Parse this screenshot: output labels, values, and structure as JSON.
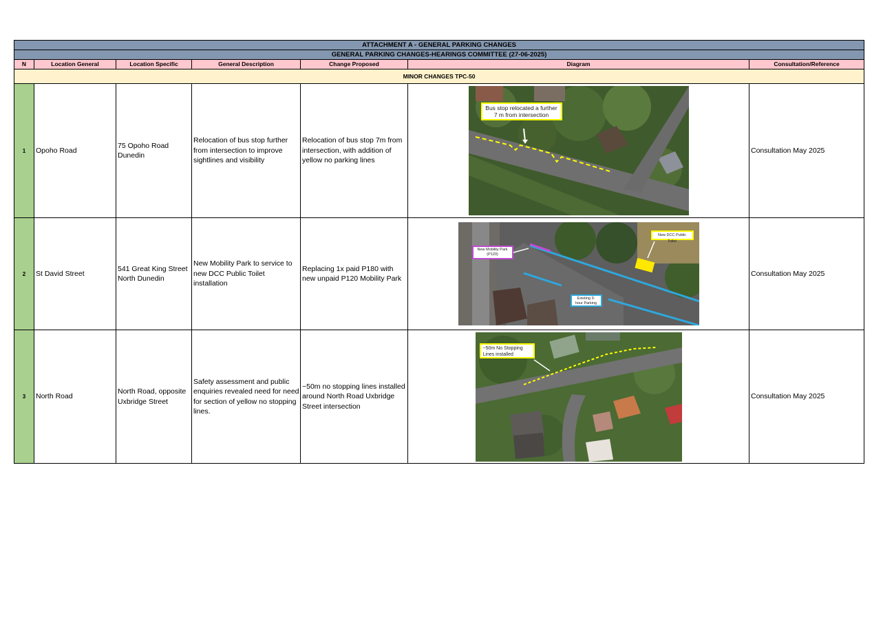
{
  "title": "ATTACHMENT A - GENERAL PARKING CHANGES",
  "subtitle": "GENERAL PARKING CHANGES-HEARINGS COMMITTEE (27-06-2025)",
  "columns": [
    "N",
    "Location General",
    "Location Specific",
    "General Description",
    "Change Proposed",
    "Diagram",
    "Consultation/Reference"
  ],
  "section": "MINOR CHANGES TPC-50",
  "rows": [
    {
      "n": "1",
      "location_general": "Opoho Road",
      "location_specific": "75 Opoho Road Dunedin",
      "description": "Relocation of bus stop further from intersection to improve sightlines and visibility",
      "change": "Relocation of bus stop 7m from intersection, with addition of yellow no parking lines",
      "consultation": "Consultation May 2025",
      "diagram_labels": [
        "Bus stop relocated a further 7 m from intersection"
      ]
    },
    {
      "n": "2",
      "location_general": "St David Street",
      "location_specific": "541 Great King Street North Dunedin",
      "description": "New Mobility Park to service to new DCC Public Toilet installation",
      "change": "Replacing 1x paid P180 with new unpaid P120 Mobility Park",
      "consultation": "Consultation May 2025",
      "diagram_labels": [
        "New Mobility Park (P120)",
        "New DCC Public Toilet",
        "Existing 3-hour Parking"
      ]
    },
    {
      "n": "3",
      "location_general": "North Road",
      "location_specific": "North Road, opposite Uxbridge Street",
      "description": "Safety assessment and public enquiries revealed need for need for section of yellow no stopping lines.",
      "change": "~50m no stopping lines installed around North Road Uxbridge Street intersection",
      "consultation": "Consultation May 2025",
      "diagram_labels": [
        "~50m No Stopping Lines installed"
      ]
    }
  ],
  "colors": {
    "title_bg": "#8497b0",
    "header_bg": "#ffc7ce",
    "section_bg": "#fff2cc",
    "number_bg": "#a9d08e",
    "yellow_line": "#ffff00",
    "mobility_line": "#c04bd1",
    "parking_line": "#2ea8dd"
  }
}
